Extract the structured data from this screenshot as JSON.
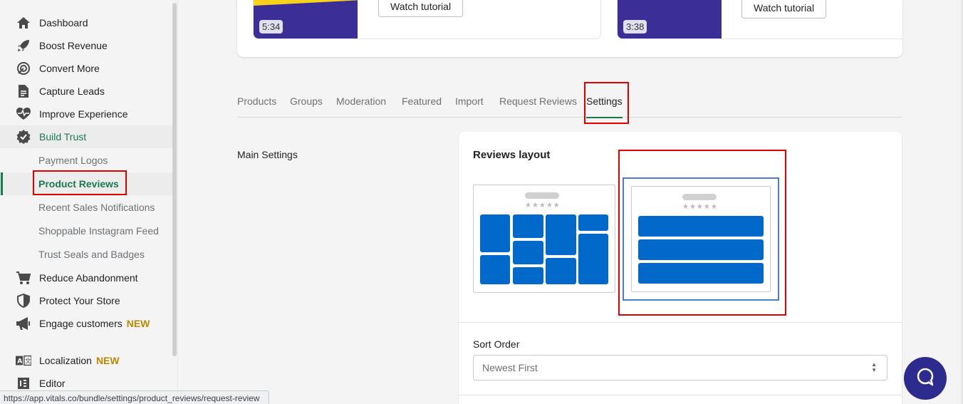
{
  "sidebar": {
    "items": [
      {
        "label": "Dashboard",
        "icon": "home-icon"
      },
      {
        "label": "Boost Revenue",
        "icon": "rocket-icon"
      },
      {
        "label": "Convert More",
        "icon": "target-icon"
      },
      {
        "label": "Capture Leads",
        "icon": "document-icon"
      },
      {
        "label": "Improve Experience",
        "icon": "heartbeat-icon"
      },
      {
        "label": "Build Trust",
        "icon": "verified-badge-icon"
      }
    ],
    "sub_items": [
      {
        "label": "Payment Logos"
      },
      {
        "label": "Product Reviews"
      },
      {
        "label": "Recent Sales Notifications"
      },
      {
        "label": "Shoppable Instagram Feed"
      },
      {
        "label": "Trust Seals and Badges"
      }
    ],
    "items_after": [
      {
        "label": "Reduce Abandonment",
        "icon": "cart-icon"
      },
      {
        "label": "Protect Your Store",
        "icon": "shield-icon"
      },
      {
        "label": "Engage customers",
        "icon": "megaphone-icon",
        "badge": "NEW"
      },
      {
        "label": "Localization",
        "icon": "translate-icon",
        "badge": "NEW"
      },
      {
        "label": "Editor",
        "icon": "editor-icon"
      }
    ]
  },
  "status_url": "https://app.vitals.co/bundle/settings/product_reviews/request-review",
  "tutorials": [
    {
      "duration": "5:34",
      "button": "Watch tutorial"
    },
    {
      "duration": "3:38",
      "button": "Watch tutorial"
    }
  ],
  "tabs": [
    "Products",
    "Groups",
    "Moderation",
    "Featured",
    "Import",
    "Request Reviews",
    "Settings"
  ],
  "active_tab": "Settings",
  "section_label": "Main Settings",
  "settings": {
    "layout_title": "Reviews layout",
    "layout_options": [
      "masonry",
      "list"
    ],
    "selected_layout": "list",
    "stars": "★★★★★",
    "sort_label": "Sort Order",
    "sort_value": "Newest First"
  },
  "colors": {
    "accent_green": "#1a7a4f",
    "layout_blue": "#0069c9",
    "highlight_red": "#e00000",
    "chat_purple": "#2e2b8f"
  }
}
